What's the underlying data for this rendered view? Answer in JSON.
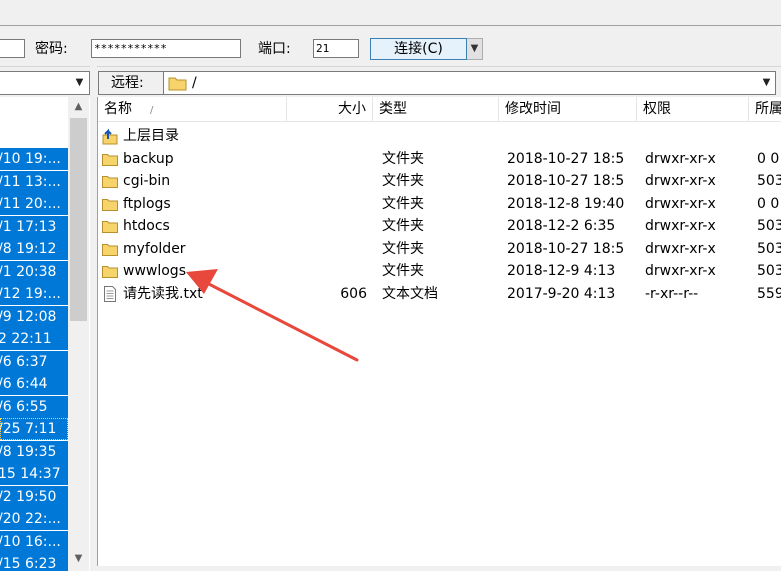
{
  "login": {
    "password_label": "密码:",
    "password_value": "***********",
    "port_label": "端口:",
    "port_value": "21",
    "connect_label": "连接(C)"
  },
  "local": {
    "rows": [
      "/10 19:...",
      "/11 13:...",
      "/11 20:...",
      "/1 17:13",
      "/8 19:12",
      "/1 20:38",
      "/12 19:...",
      "/9 12:08",
      "2 22:11",
      "/6 6:37",
      "/6 6:44",
      "/6 6:55",
      "/25 7:11",
      "/8 19:35",
      "15 14:37",
      "/2 19:50",
      "/20 22:...",
      "/10 16:...",
      "/15 6:23"
    ]
  },
  "remote": {
    "path_label": "远程:",
    "path": "/",
    "columns": {
      "name": "名称",
      "size": "大小",
      "type": "类型",
      "modified": "修改时间",
      "perms": "权限",
      "owner": "所属"
    },
    "parent_dir": "上层目录",
    "files": [
      {
        "name": "backup",
        "size": "",
        "type": "文件夹",
        "modified": "2018-10-27 18:5",
        "perms": "drwxr-xr-x",
        "owner": "0 0",
        "icon": "folder-icon"
      },
      {
        "name": "cgi-bin",
        "size": "",
        "type": "文件夹",
        "modified": "2018-10-27 18:5",
        "perms": "drwxr-xr-x",
        "owner": "503",
        "icon": "folder-icon"
      },
      {
        "name": "ftplogs",
        "size": "",
        "type": "文件夹",
        "modified": "2018-12-8 19:40",
        "perms": "drwxr-xr-x",
        "owner": "0 0",
        "icon": "folder-icon"
      },
      {
        "name": "htdocs",
        "size": "",
        "type": "文件夹",
        "modified": "2018-12-2 6:35",
        "perms": "drwxr-xr-x",
        "owner": "503",
        "icon": "folder-icon"
      },
      {
        "name": "myfolder",
        "size": "",
        "type": "文件夹",
        "modified": "2018-10-27 18:5",
        "perms": "drwxr-xr-x",
        "owner": "503",
        "icon": "folder-icon"
      },
      {
        "name": "wwwlogs",
        "size": "",
        "type": "文件夹",
        "modified": "2018-12-9 4:13",
        "perms": "drwxr-xr-x",
        "owner": "503",
        "icon": "folder-icon"
      },
      {
        "name": "请先读我.txt",
        "size": "606",
        "type": "文本文档",
        "modified": "2017-9-20 4:13",
        "perms": "-r-xr--r--",
        "owner": "559",
        "icon": "text-file-icon"
      }
    ]
  },
  "colors": {
    "selection": "#0078d7",
    "arrow": "#e8473b",
    "folder": "#f6d36b"
  }
}
